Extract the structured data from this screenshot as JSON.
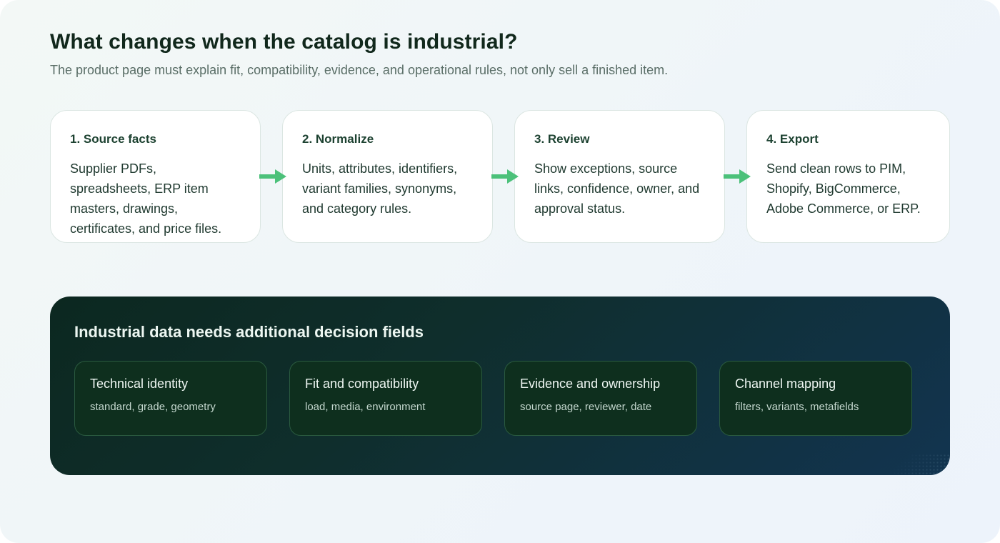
{
  "header": {
    "title": "What changes when the catalog is industrial?",
    "subtitle": "The product page must explain fit, compatibility, evidence, and operational rules, not only sell a finished item."
  },
  "steps": [
    {
      "title": "1. Source facts",
      "text": "Supplier PDFs, spreadsheets, ERP item masters, drawings, certificates, and price files."
    },
    {
      "title": "2. Normalize",
      "text": "Units, attributes, identifiers, variant families, synonyms, and category rules."
    },
    {
      "title": "3. Review",
      "text": "Show exceptions, source links, confidence, owner, and approval status."
    },
    {
      "title": "4. Export",
      "text": "Send clean rows to PIM, Shopify, BigCommerce, Adobe Commerce, or ERP."
    }
  ],
  "decision_panel": {
    "title": "Industrial data needs additional decision fields",
    "fields": [
      {
        "title": "Technical identity",
        "desc": "standard, grade, geometry"
      },
      {
        "title": "Fit and compatibility",
        "desc": "load, media, environment"
      },
      {
        "title": "Evidence and ownership",
        "desc": "source page, reviewer, date"
      },
      {
        "title": "Channel mapping",
        "desc": "filters, variants, metafields"
      }
    ]
  },
  "colors": {
    "arrow": "#4cc17a",
    "panel_bg": "#0f2e2c",
    "card_bg": "#ffffff"
  },
  "icons": {
    "step_connector": "arrow-right-icon"
  }
}
